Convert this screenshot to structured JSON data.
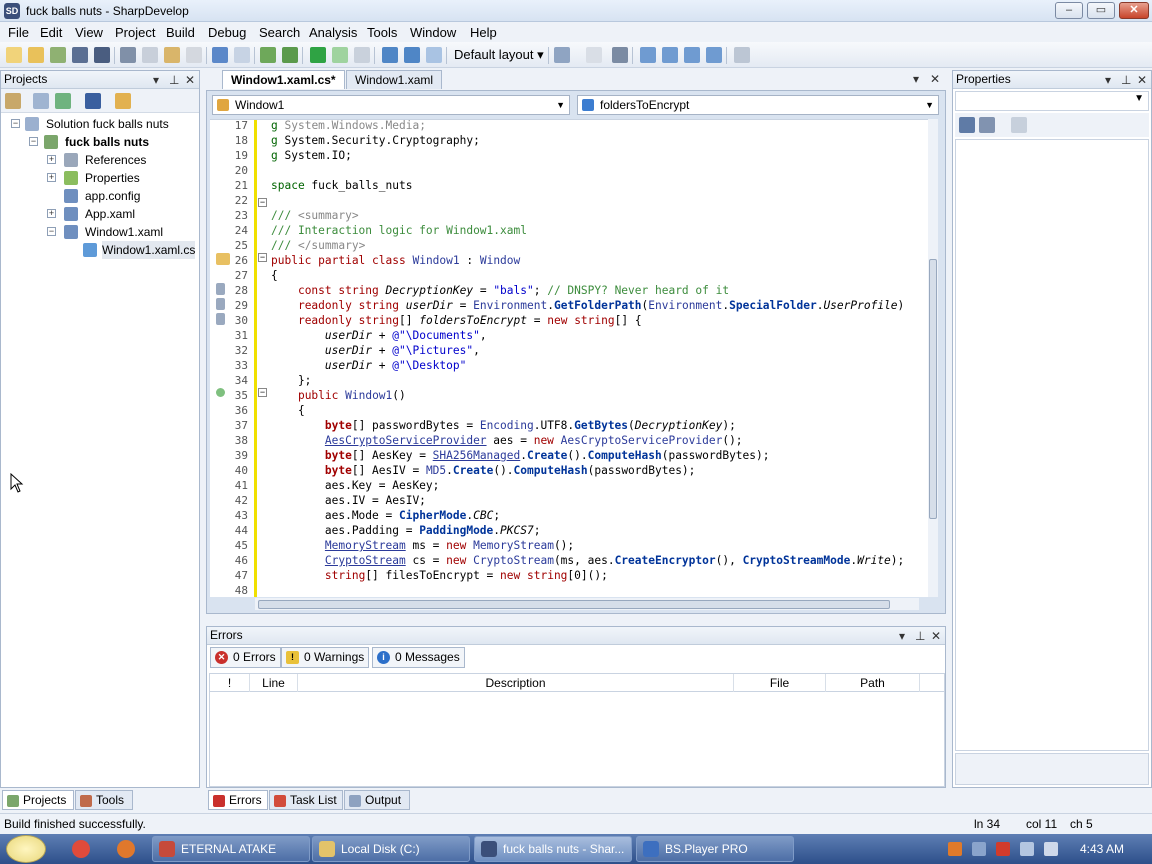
{
  "window": {
    "title": "fuck balls nuts - SharpDevelop",
    "min": "–",
    "max": "▭",
    "close": "✕",
    "app_icon": "SD"
  },
  "menu": [
    "File",
    "Edit",
    "View",
    "Project",
    "Build",
    "Debug",
    "Search",
    "Analysis",
    "Tools",
    "Window",
    "Help"
  ],
  "toolbar": {
    "layout": "Default layout"
  },
  "projects_pane": {
    "title": "Projects",
    "tree": [
      {
        "label": "Solution fuck balls nuts",
        "bold": false
      },
      {
        "label": "fuck balls nuts",
        "bold": true
      },
      {
        "label": "References",
        "bold": false
      },
      {
        "label": "Properties",
        "bold": false
      },
      {
        "label": "app.config",
        "bold": false
      },
      {
        "label": "App.xaml",
        "bold": false
      },
      {
        "label": "Window1.xaml",
        "bold": false
      },
      {
        "label": "Window1.xaml.cs",
        "bold": false
      }
    ],
    "tabs": [
      "Projects",
      "Tools"
    ]
  },
  "editor": {
    "tabs": [
      "Window1.xaml.cs*",
      "Window1.xaml"
    ],
    "class_combo": "Window1",
    "member_combo": "foldersToEncrypt",
    "line_numbers": [
      "17",
      "18",
      "19",
      "20",
      "21",
      "22",
      "23",
      "24",
      "25",
      "26",
      "27",
      "28",
      "29",
      "30",
      "31",
      "32",
      "33",
      "34",
      "35",
      "36",
      "37",
      "38",
      "39",
      "40",
      "41",
      "42",
      "43",
      "44",
      "45",
      "46",
      "47",
      "48"
    ]
  },
  "errors_pane": {
    "title": "Errors",
    "buttons": [
      "0 Errors",
      "0 Warnings",
      "0 Messages"
    ],
    "columns": [
      "!",
      "Line",
      "Description",
      "File",
      "Path"
    ]
  },
  "bottom_tabs": [
    "Errors",
    "Task List",
    "Output"
  ],
  "properties_pane": {
    "title": "Properties"
  },
  "status": {
    "message": "Build finished successfully.",
    "ln": "ln 34",
    "col": "col 11",
    "ch": "ch 5"
  },
  "taskbar": {
    "apps": [
      "ETERNAL ATAKE",
      "Local Disk (C:)",
      "fuck balls nuts - Shar...",
      "BS.Player PRO"
    ],
    "clock": "4:43 AM"
  }
}
